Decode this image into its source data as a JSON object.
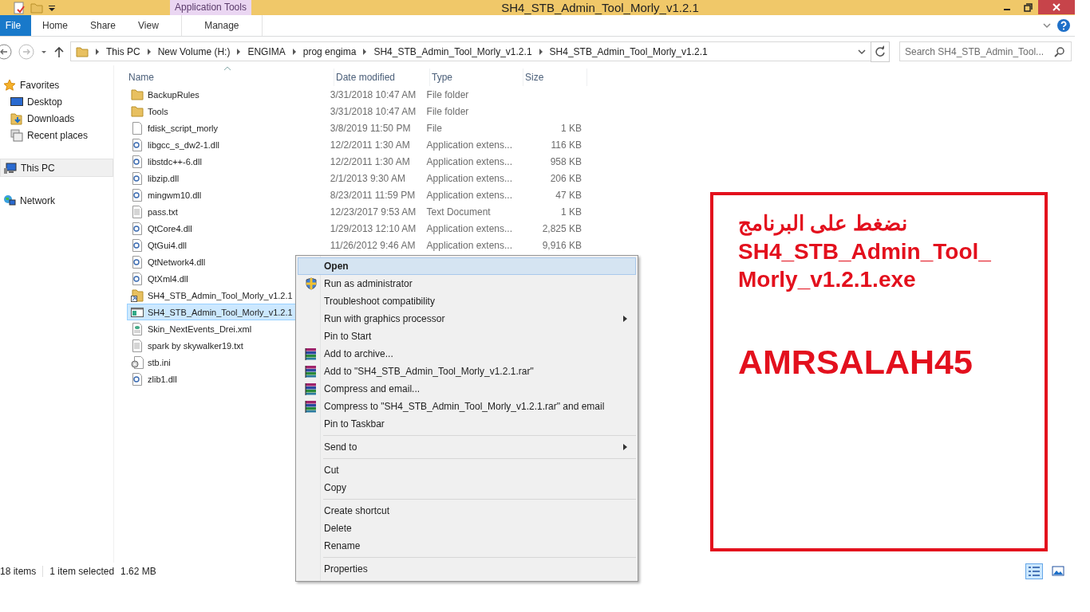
{
  "window": {
    "title": "SH4_STB_Admin_Tool_Morly_v1.2.1",
    "context_group": "Application Tools"
  },
  "ribbon_tabs": [
    {
      "label": "File",
      "kind": "file"
    },
    {
      "label": "Home",
      "kind": "normal"
    },
    {
      "label": "Share",
      "kind": "normal"
    },
    {
      "label": "View",
      "kind": "normal"
    },
    {
      "label": "Manage",
      "kind": "contextual"
    }
  ],
  "address": {
    "crumbs": [
      "This PC",
      "New Volume (H:)",
      "ENGIMA",
      "prog engima",
      "SH4_STB_Admin_Tool_Morly_v1.2.1",
      "SH4_STB_Admin_Tool_Morly_v1.2.1"
    ]
  },
  "search": {
    "placeholder": "Search SH4_STB_Admin_Tool..."
  },
  "sidebar": {
    "sections": [
      {
        "label": "Favorites",
        "kind": "favorites",
        "selected": false,
        "children": [
          {
            "label": "Desktop",
            "kind": "desktop",
            "selected": false
          },
          {
            "label": "Downloads",
            "kind": "downloads",
            "selected": false
          },
          {
            "label": "Recent places",
            "kind": "recent",
            "selected": false
          }
        ]
      },
      {
        "label": "This PC",
        "kind": "pc",
        "selected": true
      },
      {
        "label": "Network",
        "kind": "network",
        "selected": false
      }
    ]
  },
  "table": {
    "columns": [
      "Name",
      "Date modified",
      "Type",
      "Size"
    ],
    "rows": [
      {
        "name": "BackupRules",
        "kind": "folder",
        "date": "3/31/2018 10:47 AM",
        "type": "File folder",
        "selected": false
      },
      {
        "name": "Tools",
        "kind": "folder",
        "date": "3/31/2018 10:47 AM",
        "type": "File folder",
        "selected": false
      },
      {
        "name": "fdisk_script_morly",
        "kind": "file",
        "date": "3/8/2019 11:50 PM",
        "type": "File",
        "size": "1 KB",
        "selected": false
      },
      {
        "name": "libgcc_s_dw2-1.dll",
        "kind": "dll",
        "date": "12/2/2011 1:30 AM",
        "type": "Application extens...",
        "size": "116 KB",
        "selected": false
      },
      {
        "name": "libstdc++-6.dll",
        "kind": "dll",
        "date": "12/2/2011 1:30 AM",
        "type": "Application extens...",
        "size": "958 KB",
        "selected": false
      },
      {
        "name": "libzip.dll",
        "kind": "dll",
        "date": "2/1/2013 9:30 AM",
        "type": "Application extens...",
        "size": "206 KB",
        "selected": false
      },
      {
        "name": "mingwm10.dll",
        "kind": "dll",
        "date": "8/23/2011 11:59 PM",
        "type": "Application extens...",
        "size": "47 KB",
        "selected": false
      },
      {
        "name": "pass.txt",
        "kind": "txt",
        "date": "12/23/2017 9:53 AM",
        "type": "Text Document",
        "size": "1 KB",
        "selected": false
      },
      {
        "name": "QtCore4.dll",
        "kind": "dll",
        "date": "1/29/2013 12:10 AM",
        "type": "Application extens...",
        "size": "2,825 KB",
        "selected": false
      },
      {
        "name": "QtGui4.dll",
        "kind": "dll",
        "date": "11/26/2012 9:46 AM",
        "type": "Application extens...",
        "size": "9,916 KB",
        "selected": false
      },
      {
        "name": "QtNetwork4.dll",
        "kind": "dll",
        "selected": false
      },
      {
        "name": "QtXml4.dll",
        "kind": "dll",
        "selected": false
      },
      {
        "name": "SH4_STB_Admin_Tool_Morly_v1.2.1",
        "kind": "shortcut",
        "selected": false
      },
      {
        "name": "SH4_STB_Admin_Tool_Morly_v1.2.1",
        "kind": "exe",
        "selected": true
      },
      {
        "name": "Skin_NextEvents_Drei.xml",
        "kind": "xml",
        "selected": false
      },
      {
        "name": "spark by skywalker19.txt",
        "kind": "txt",
        "selected": false
      },
      {
        "name": "stb.ini",
        "kind": "ini",
        "selected": false
      },
      {
        "name": "zlib1.dll",
        "kind": "dll",
        "selected": false
      }
    ]
  },
  "context_menu": {
    "groups": [
      [
        {
          "label": "Open",
          "kind": "plain",
          "default": true,
          "selected": true
        },
        {
          "label": "Run as administrator",
          "kind": "shield",
          "default": false,
          "selected": false
        },
        {
          "label": "Troubleshoot compatibility",
          "kind": "plain",
          "default": false,
          "selected": false
        },
        {
          "label": "Run with graphics processor",
          "kind": "submenu",
          "default": false,
          "selected": false
        },
        {
          "label": "Pin to Start",
          "kind": "plain",
          "default": false,
          "selected": false
        },
        {
          "label": "Add to archive...",
          "kind": "archive",
          "default": false,
          "selected": false
        },
        {
          "label": "Add to \"SH4_STB_Admin_Tool_Morly_v1.2.1.rar\"",
          "kind": "archive",
          "default": false,
          "selected": false
        },
        {
          "label": "Compress and email...",
          "kind": "archive",
          "default": false,
          "selected": false
        },
        {
          "label": "Compress to \"SH4_STB_Admin_Tool_Morly_v1.2.1.rar\" and email",
          "kind": "archive",
          "default": false,
          "selected": false
        },
        {
          "label": "Pin to Taskbar",
          "kind": "plain",
          "default": false,
          "selected": false
        }
      ],
      [
        {
          "label": "Send to",
          "kind": "submenu",
          "default": false,
          "selected": false
        }
      ],
      [
        {
          "label": "Cut",
          "kind": "plain",
          "default": false,
          "selected": false
        },
        {
          "label": "Copy",
          "kind": "plain",
          "default": false,
          "selected": false
        }
      ],
      [
        {
          "label": "Create shortcut",
          "kind": "plain",
          "default": false,
          "selected": false
        },
        {
          "label": "Delete",
          "kind": "plain",
          "default": false,
          "selected": false
        },
        {
          "label": "Rename",
          "kind": "plain",
          "default": false,
          "selected": false
        }
      ],
      [
        {
          "label": "Properties",
          "kind": "plain",
          "default": false,
          "selected": false
        }
      ]
    ]
  },
  "status_bar": {
    "count": "18 items",
    "selection": "1 item selected",
    "size": "1.62 MB"
  },
  "annotation": {
    "lines": [
      "نضغط على البرنامج",
      "SH4_STB_Admin_Tool_",
      "Morly_v1.2.1.exe"
    ],
    "signature": "AMRSALAH45"
  }
}
